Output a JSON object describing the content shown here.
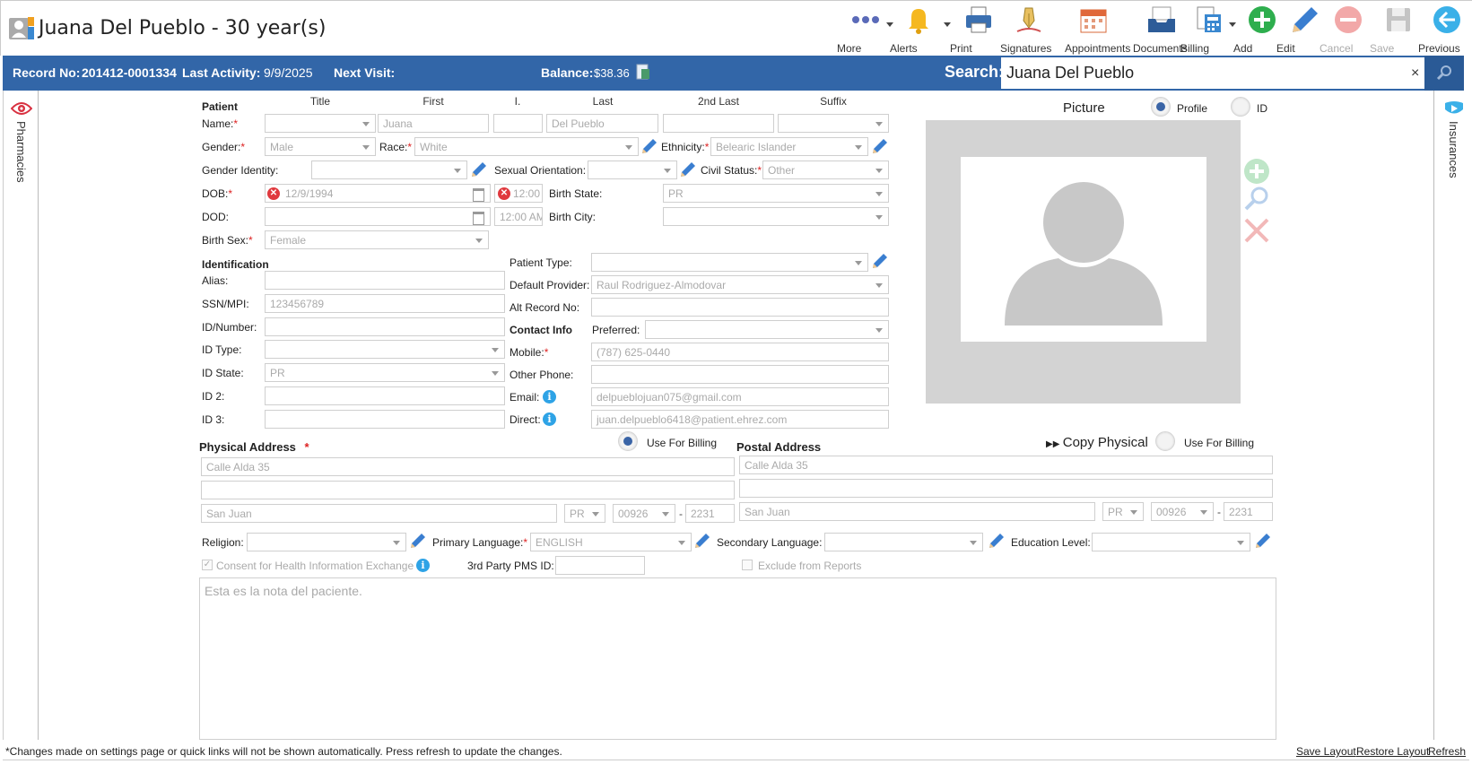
{
  "header": {
    "title": "Juana Del Pueblo - 30 year(s)",
    "toolbar": {
      "more": "More",
      "alerts": "Alerts",
      "print": "Print",
      "signatures": "Signatures",
      "appointments": "Appointments",
      "documents": "Documents",
      "billing": "Billing",
      "add": "Add",
      "edit": "Edit",
      "cancel": "Cancel",
      "save": "Save",
      "previous": "Previous"
    }
  },
  "info_bar": {
    "record_label": "Record No:",
    "record_value": "201412-0001334",
    "activity_label": "Last Activity:",
    "activity_value": "9/9/2025",
    "next_visit_label": "Next Visit:",
    "balance_label": "Balance:",
    "balance_value": "$38.36",
    "search_label": "Search:",
    "search_value": "Juana Del Pueblo",
    "clear": "×"
  },
  "side_tabs": {
    "left": "Pharmacies",
    "right": "Insurances"
  },
  "patient": {
    "section": "Patient",
    "col_headers": {
      "title": "Title",
      "first": "First",
      "initial": "I.",
      "last": "Last",
      "second_last": "2nd Last",
      "suffix": "Suffix"
    },
    "name_label": "Name:",
    "first": "Juana",
    "last": "Del Pueblo",
    "gender_label": "Gender:",
    "gender": "Male",
    "race_label": "Race:",
    "race": "White",
    "ethnicity_label": "Ethnicity:",
    "ethnicity": "Belearic Islander",
    "gender_identity_label": "Gender Identity:",
    "sexual_orientation_label": "Sexual Orientation:",
    "civil_status_label": "Civil Status:",
    "civil_status": "Other",
    "dob_label": "DOB:",
    "dob": "12/9/1994",
    "dob_time": "12:00",
    "birth_state_label": "Birth State:",
    "birth_state": "PR",
    "dod_label": "DOD:",
    "dod_time": "12:00 AM",
    "birth_city_label": "Birth City:",
    "birth_sex_label": "Birth Sex:",
    "birth_sex": "Female",
    "req": "*"
  },
  "identification": {
    "section": "Identification",
    "alias_label": "Alias:",
    "ssn_label": "SSN/MPI:",
    "ssn": "123456789",
    "id_number_label": "ID/Number:",
    "id_type_label": "ID Type:",
    "id_state_label": "ID State:",
    "id_state": "PR",
    "id2_label": "ID 2:",
    "id3_label": "ID 3:"
  },
  "details": {
    "patient_type_label": "Patient Type:",
    "default_provider_label": "Default Provider:",
    "default_provider": "Raul Rodriguez-Almodovar",
    "alt_record_label": "Alt Record No:"
  },
  "contact": {
    "section": "Contact Info",
    "preferred_label": "Preferred:",
    "mobile_label": "Mobile:",
    "mobile": "(787) 625-0440",
    "other_phone_label": "Other Phone:",
    "email_label": "Email:",
    "email": "delpueblojuan075@gmail.com",
    "direct_label": "Direct:",
    "direct": "juan.delpueblo6418@patient.ehrez.com",
    "info": "i"
  },
  "picture": {
    "label": "Picture",
    "profile_label": "Profile",
    "id_label": "ID"
  },
  "physical_address": {
    "section": "Physical Address",
    "use_for_billing": "Use For Billing",
    "line1": "Calle Alda 35",
    "city": "San Juan",
    "state": "PR",
    "zip": "00926",
    "zip4": "2231"
  },
  "postal_address": {
    "section": "Postal Address",
    "copy_physical": "Copy Physical",
    "use_for_billing": "Use For Billing",
    "line1": "Calle Alda 35",
    "city": "San Juan",
    "state": "PR",
    "zip": "00926",
    "zip4": "2231"
  },
  "other": {
    "religion_label": "Religion:",
    "primary_language_label": "Primary Language:",
    "primary_language": "ENGLISH",
    "secondary_language_label": "Secondary Language:",
    "education_label": "Education Level:",
    "consent_label": "Consent for Health Information Exchange",
    "third_party_label": "3rd Party PMS ID:",
    "exclude_label": "Exclude from Reports",
    "check": "✓"
  },
  "notes": "Esta es la nota del paciente.",
  "footer": {
    "note": "*Changes made on settings page or quick links will not be shown automatically. Press refresh to update the changes.",
    "save_layout": "Save Layout",
    "restore_layout": "Restore Layout",
    "refresh": "Refresh"
  },
  "colors": {
    "accent": "#3266a8",
    "required": "#dd2222",
    "info": "#2ea3e6"
  }
}
